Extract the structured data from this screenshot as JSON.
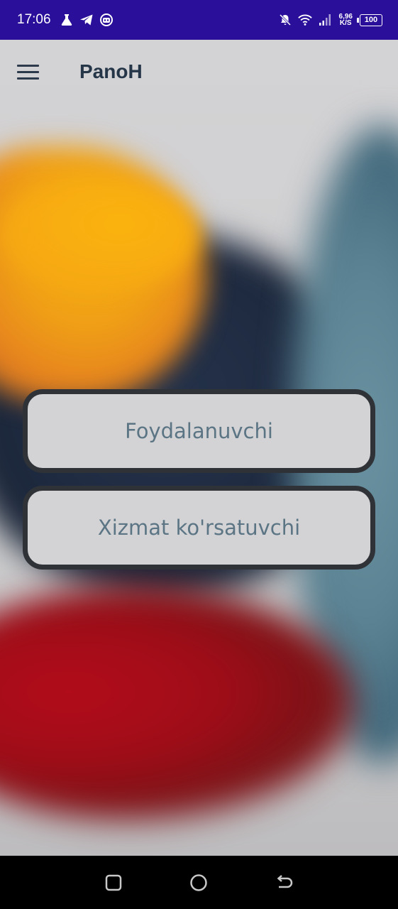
{
  "status_bar": {
    "time": "17:06",
    "net_speed_value": "6,96",
    "net_speed_unit": "K/S",
    "battery": "100",
    "icons": [
      "flask-icon",
      "telegram-icon",
      "bot-icon",
      "bell-off-icon",
      "wifi-icon",
      "signal-icon",
      "battery-icon"
    ]
  },
  "app_bar": {
    "title": "PanoH",
    "menu_icon": "hamburger-menu-icon"
  },
  "main": {
    "buttons": [
      {
        "label": "Foydalanuvchi"
      },
      {
        "label": "Xizmat ko'rsatuvchi"
      }
    ]
  },
  "nav_bar": {
    "icons": [
      "recent-apps-icon",
      "home-icon",
      "back-icon"
    ]
  },
  "colors": {
    "status_bar_bg": "#2a0f9a",
    "title_text": "#263649",
    "button_text": "#5b7585",
    "button_border": "#2f3338",
    "button_fill": "#d3d2d4"
  }
}
